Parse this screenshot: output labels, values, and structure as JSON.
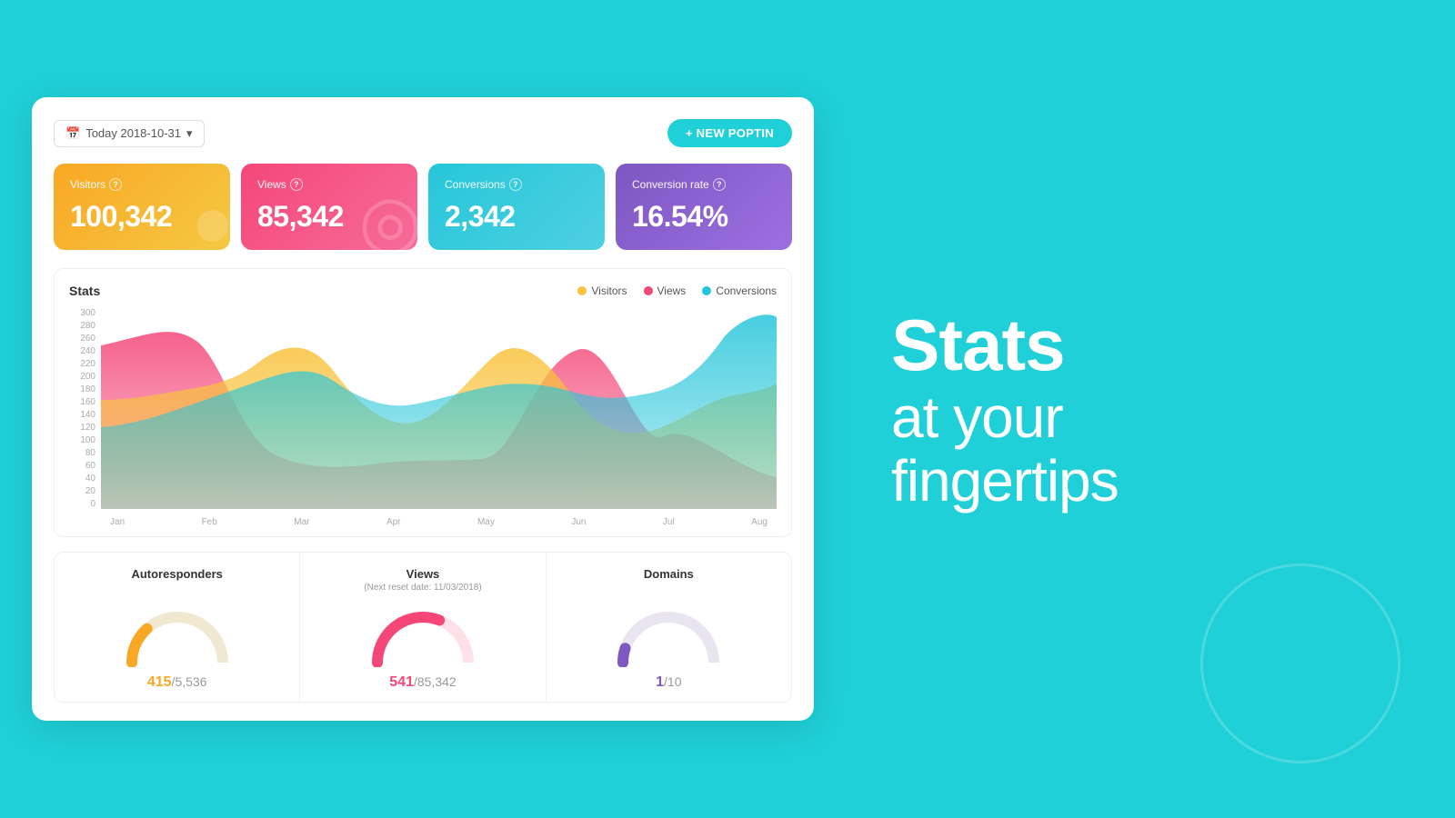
{
  "header": {
    "date_label": "Today 2018-10-31",
    "new_poptin_label": "+ NEW POPTIN"
  },
  "stat_cards": [
    {
      "id": "visitors",
      "label": "Visitors",
      "value": "100,342",
      "color_class": "visitors"
    },
    {
      "id": "views",
      "label": "Views",
      "value": "85,342",
      "color_class": "views"
    },
    {
      "id": "conversions",
      "label": "Conversions",
      "value": "2,342",
      "color_class": "conversions"
    },
    {
      "id": "conv-rate",
      "label": "Conversion rate",
      "value": "16.54%",
      "color_class": "conv-rate"
    }
  ],
  "chart": {
    "title": "Stats",
    "legend": [
      {
        "label": "Visitors",
        "color": "#f9c23c"
      },
      {
        "label": "Views",
        "color": "#f44778"
      },
      {
        "label": "Conversions",
        "color": "#26c6da"
      }
    ],
    "y_labels": [
      "300",
      "280",
      "260",
      "240",
      "220",
      "200",
      "180",
      "160",
      "140",
      "120",
      "100",
      "80",
      "60",
      "40",
      "20",
      "0"
    ],
    "x_labels": [
      "Jan",
      "Feb",
      "Mar",
      "Apr",
      "May",
      "Jun",
      "Jul",
      "Aug"
    ]
  },
  "gauges": [
    {
      "title": "Autoresponders",
      "subtitle": "",
      "current": "415",
      "total": "5,536",
      "color": "#f9a825",
      "percent": 0.27
    },
    {
      "title": "Views",
      "subtitle": "(Next reset date: 11/03/2018)",
      "current": "541",
      "total": "85,342",
      "color": "#f44778",
      "percent": 0.62
    },
    {
      "title": "Domains",
      "subtitle": "",
      "current": "1",
      "total": "10",
      "color": "#7e57c2",
      "percent": 0.1
    }
  ],
  "hero": {
    "line1": "Stats",
    "line2": "at your",
    "line3": "fingertips"
  }
}
